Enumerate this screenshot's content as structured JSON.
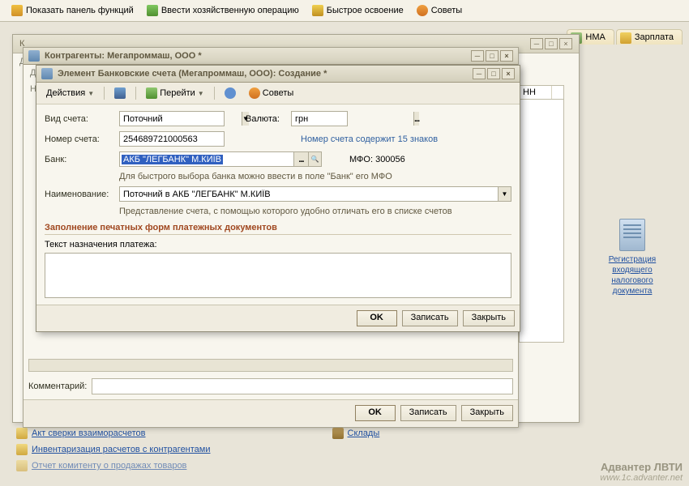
{
  "topToolbar": {
    "showPanel": "Показать панель функций",
    "enterOp": "Ввести хозяйственную операцию",
    "fastLearn": "Быстрое освоение",
    "tips": "Советы"
  },
  "sideTabs": {
    "nma": "НМА",
    "salary": "Зарплата"
  },
  "bgWindow": {
    "titlePrefix": "К",
    "letter1": "Д",
    "letter2": "Д",
    "letter3": "Н"
  },
  "parentWindow": {
    "title": "Контрагенты: Мегапроммаш, ООО *",
    "commentLabel": "Комментарий:",
    "ok": "OK",
    "save": "Записать",
    "close": "Закрыть"
  },
  "mainWindow": {
    "title": "Элемент Банковские счета (Мегапроммаш, ООО): Создание *",
    "toolbar": {
      "actions": "Действия",
      "go": "Перейти",
      "tips": "Советы"
    },
    "form": {
      "accountTypeLabel": "Вид счета:",
      "accountTypeValue": "Поточний",
      "currencyLabel": "Валюта:",
      "currencyValue": "грн",
      "accountNumberLabel": "Номер счета:",
      "accountNumberValue": "254689721000563",
      "accountNumberHint": "Номер счета содержит 15 знаков",
      "bankLabel": "Банк:",
      "bankValue": "АКБ \"ЛЕГБАНК\" М.КИЇВ",
      "mfoLabel": "МФО: 300056",
      "bankHint": "Для быстрого выбора банка можно ввести в поле \"Банк\" его МФО",
      "nameLabel": "Наименование:",
      "nameValue": "Поточний в АКБ \"ЛЕГБАНК\" М.КИЇВ",
      "nameHint": "Представление счета, с помощью которого удобно отличать его в списке счетов",
      "sectionTitle": "Заполнение печатных форм платежных документов",
      "paymentTextLabel": "Текст назначения платежа:"
    },
    "buttons": {
      "ok": "OK",
      "save": "Записать",
      "close": "Закрыть"
    }
  },
  "rightPanel": {
    "linkText": "Регистрация входящего налогового документа"
  },
  "bottomLinks": {
    "act": "Акт сверки взаиморасчетов",
    "inventory": "Инвентаризация расчетов с контрагентами",
    "report": "Отчет комитенту о продажах товаров",
    "warehouses": "Склады"
  },
  "tableHeader": {
    "col": "НН"
  },
  "watermark": {
    "brand": "Адвантер ЛВТИ",
    "url": "www.1c.advanter.net"
  }
}
